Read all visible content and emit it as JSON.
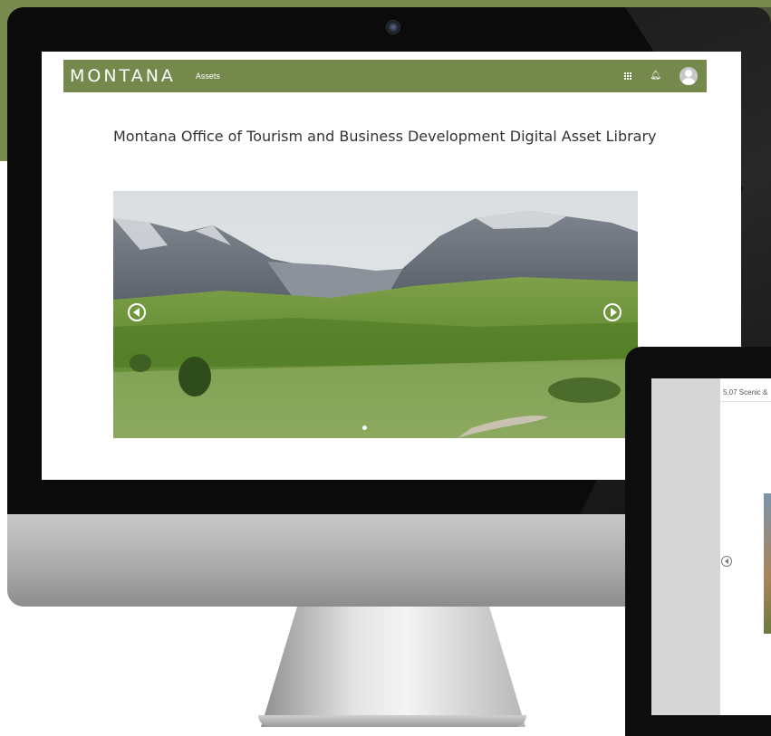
{
  "app": {
    "brand": "MONTANA",
    "nav_link": "Assets",
    "icons": [
      "apps-grid-icon",
      "bell-icon",
      "avatar-icon"
    ],
    "accent_color": "#76894d"
  },
  "main": {
    "title": "Montana Office of Tourism and Business Development Digital Asset Library",
    "carousel": {
      "active_slide": 1,
      "slide_count": 1
    }
  },
  "tablet": {
    "caption": "5.07 Scenic &"
  }
}
